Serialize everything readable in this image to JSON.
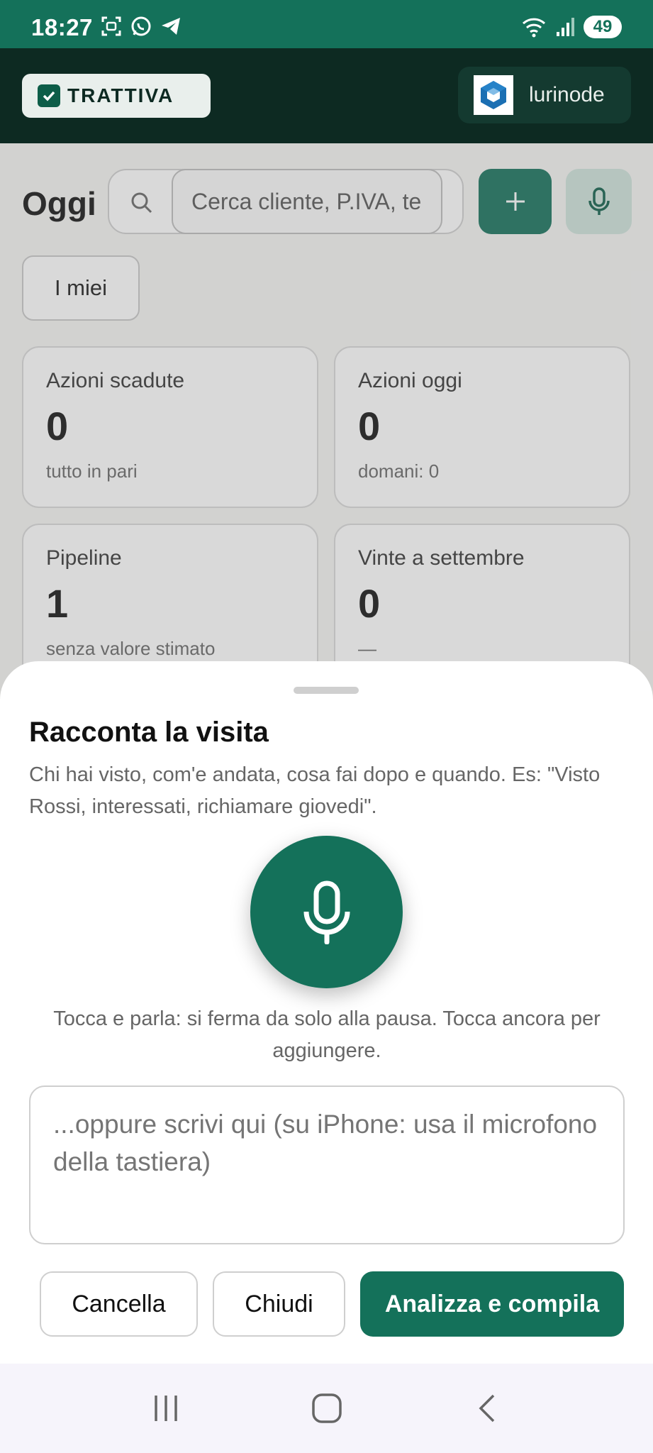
{
  "status_bar": {
    "time": "18:27",
    "battery": "49",
    "left_icons": [
      "screenshot-icon",
      "whatsapp-icon",
      "telegram-icon"
    ],
    "right_icons": [
      "wifi-icon",
      "signal-icon"
    ]
  },
  "header": {
    "brand": "TRATTIVA",
    "account": "lurinode"
  },
  "toolbar": {
    "title": "Oggi",
    "search_placeholder": "Cerca cliente, P.IVA, te",
    "filter_chip": "I miei"
  },
  "cards": [
    {
      "label": "Azioni scadute",
      "value": "0",
      "sub": "tutto in pari"
    },
    {
      "label": "Azioni oggi",
      "value": "0",
      "sub": "domani: 0"
    },
    {
      "label": "Pipeline",
      "value": "1",
      "sub": "senza valore stimato"
    },
    {
      "label": "Vinte a settembre",
      "value": "0",
      "sub": "—"
    }
  ],
  "sheet": {
    "title": "Racconta la visita",
    "description": "Chi hai visto, com'e andata, cosa fai dopo e quando. Es: \"Visto Rossi, interessati, richiamare giovedi\".",
    "record_hint": "Tocca e parla: si ferma da solo alla pausa. Tocca ancora per aggiungere.",
    "notes_placeholder": "...oppure scrivi qui (su iPhone: usa il microfono della tastiera)",
    "cancel_label": "Cancella",
    "close_label": "Chiudi",
    "analyze_label": "Analizza e compila"
  },
  "colors": {
    "brand_green": "#14715a",
    "header_dark": "#0d2a22"
  }
}
